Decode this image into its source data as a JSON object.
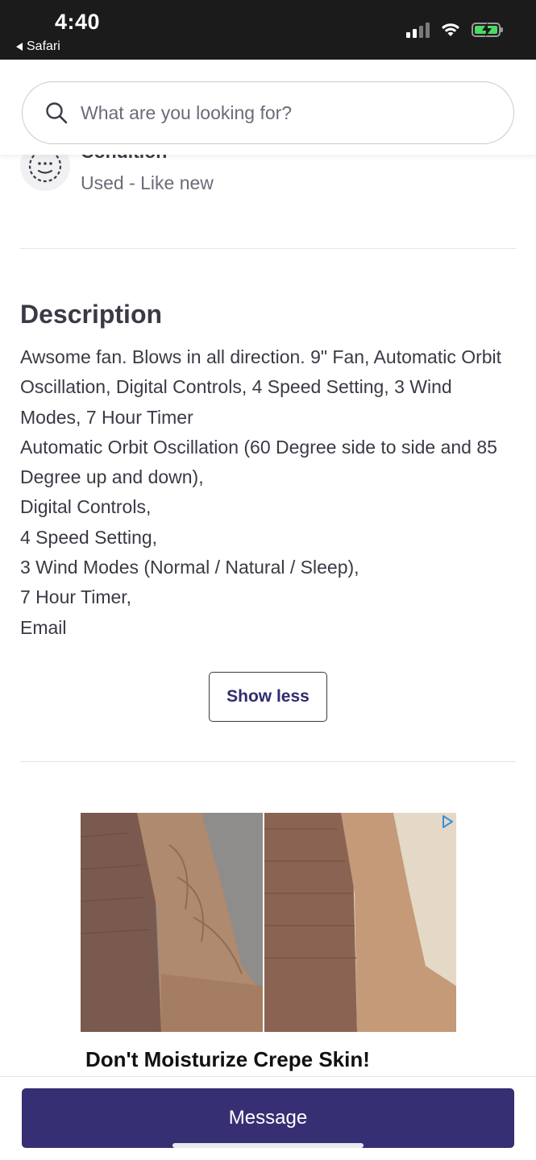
{
  "status_bar": {
    "time": "4:40",
    "back_app": "Safari"
  },
  "search": {
    "placeholder": "What are you looking for?"
  },
  "condition": {
    "label": "Condition",
    "value": "Used - Like new"
  },
  "description": {
    "title": "Description",
    "lines": [
      "Awsome fan. Blows in all direction. 9\" Fan, Automatic Orbit Oscillation, Digital Controls, 4 Speed Setting, 3 Wind Modes, 7 Hour Timer",
      "Automatic Orbit Oscillation (60 Degree side to side and 85 Degree up and down),",
      "Digital Controls,",
      "4 Speed Setting,",
      "3 Wind Modes (Normal / Natural / Sleep),",
      "7 Hour Timer,",
      "Email"
    ],
    "toggle_label": "Show less"
  },
  "ad": {
    "headline": "Don't Moisturize Crepe Skin!"
  },
  "bottom_bar": {
    "message_label": "Message"
  },
  "colors": {
    "primary": "#372f73",
    "text": "#3a3a46",
    "muted": "#6b6b78",
    "status_bar": "#1b1b1b",
    "battery": "#4cd964"
  }
}
